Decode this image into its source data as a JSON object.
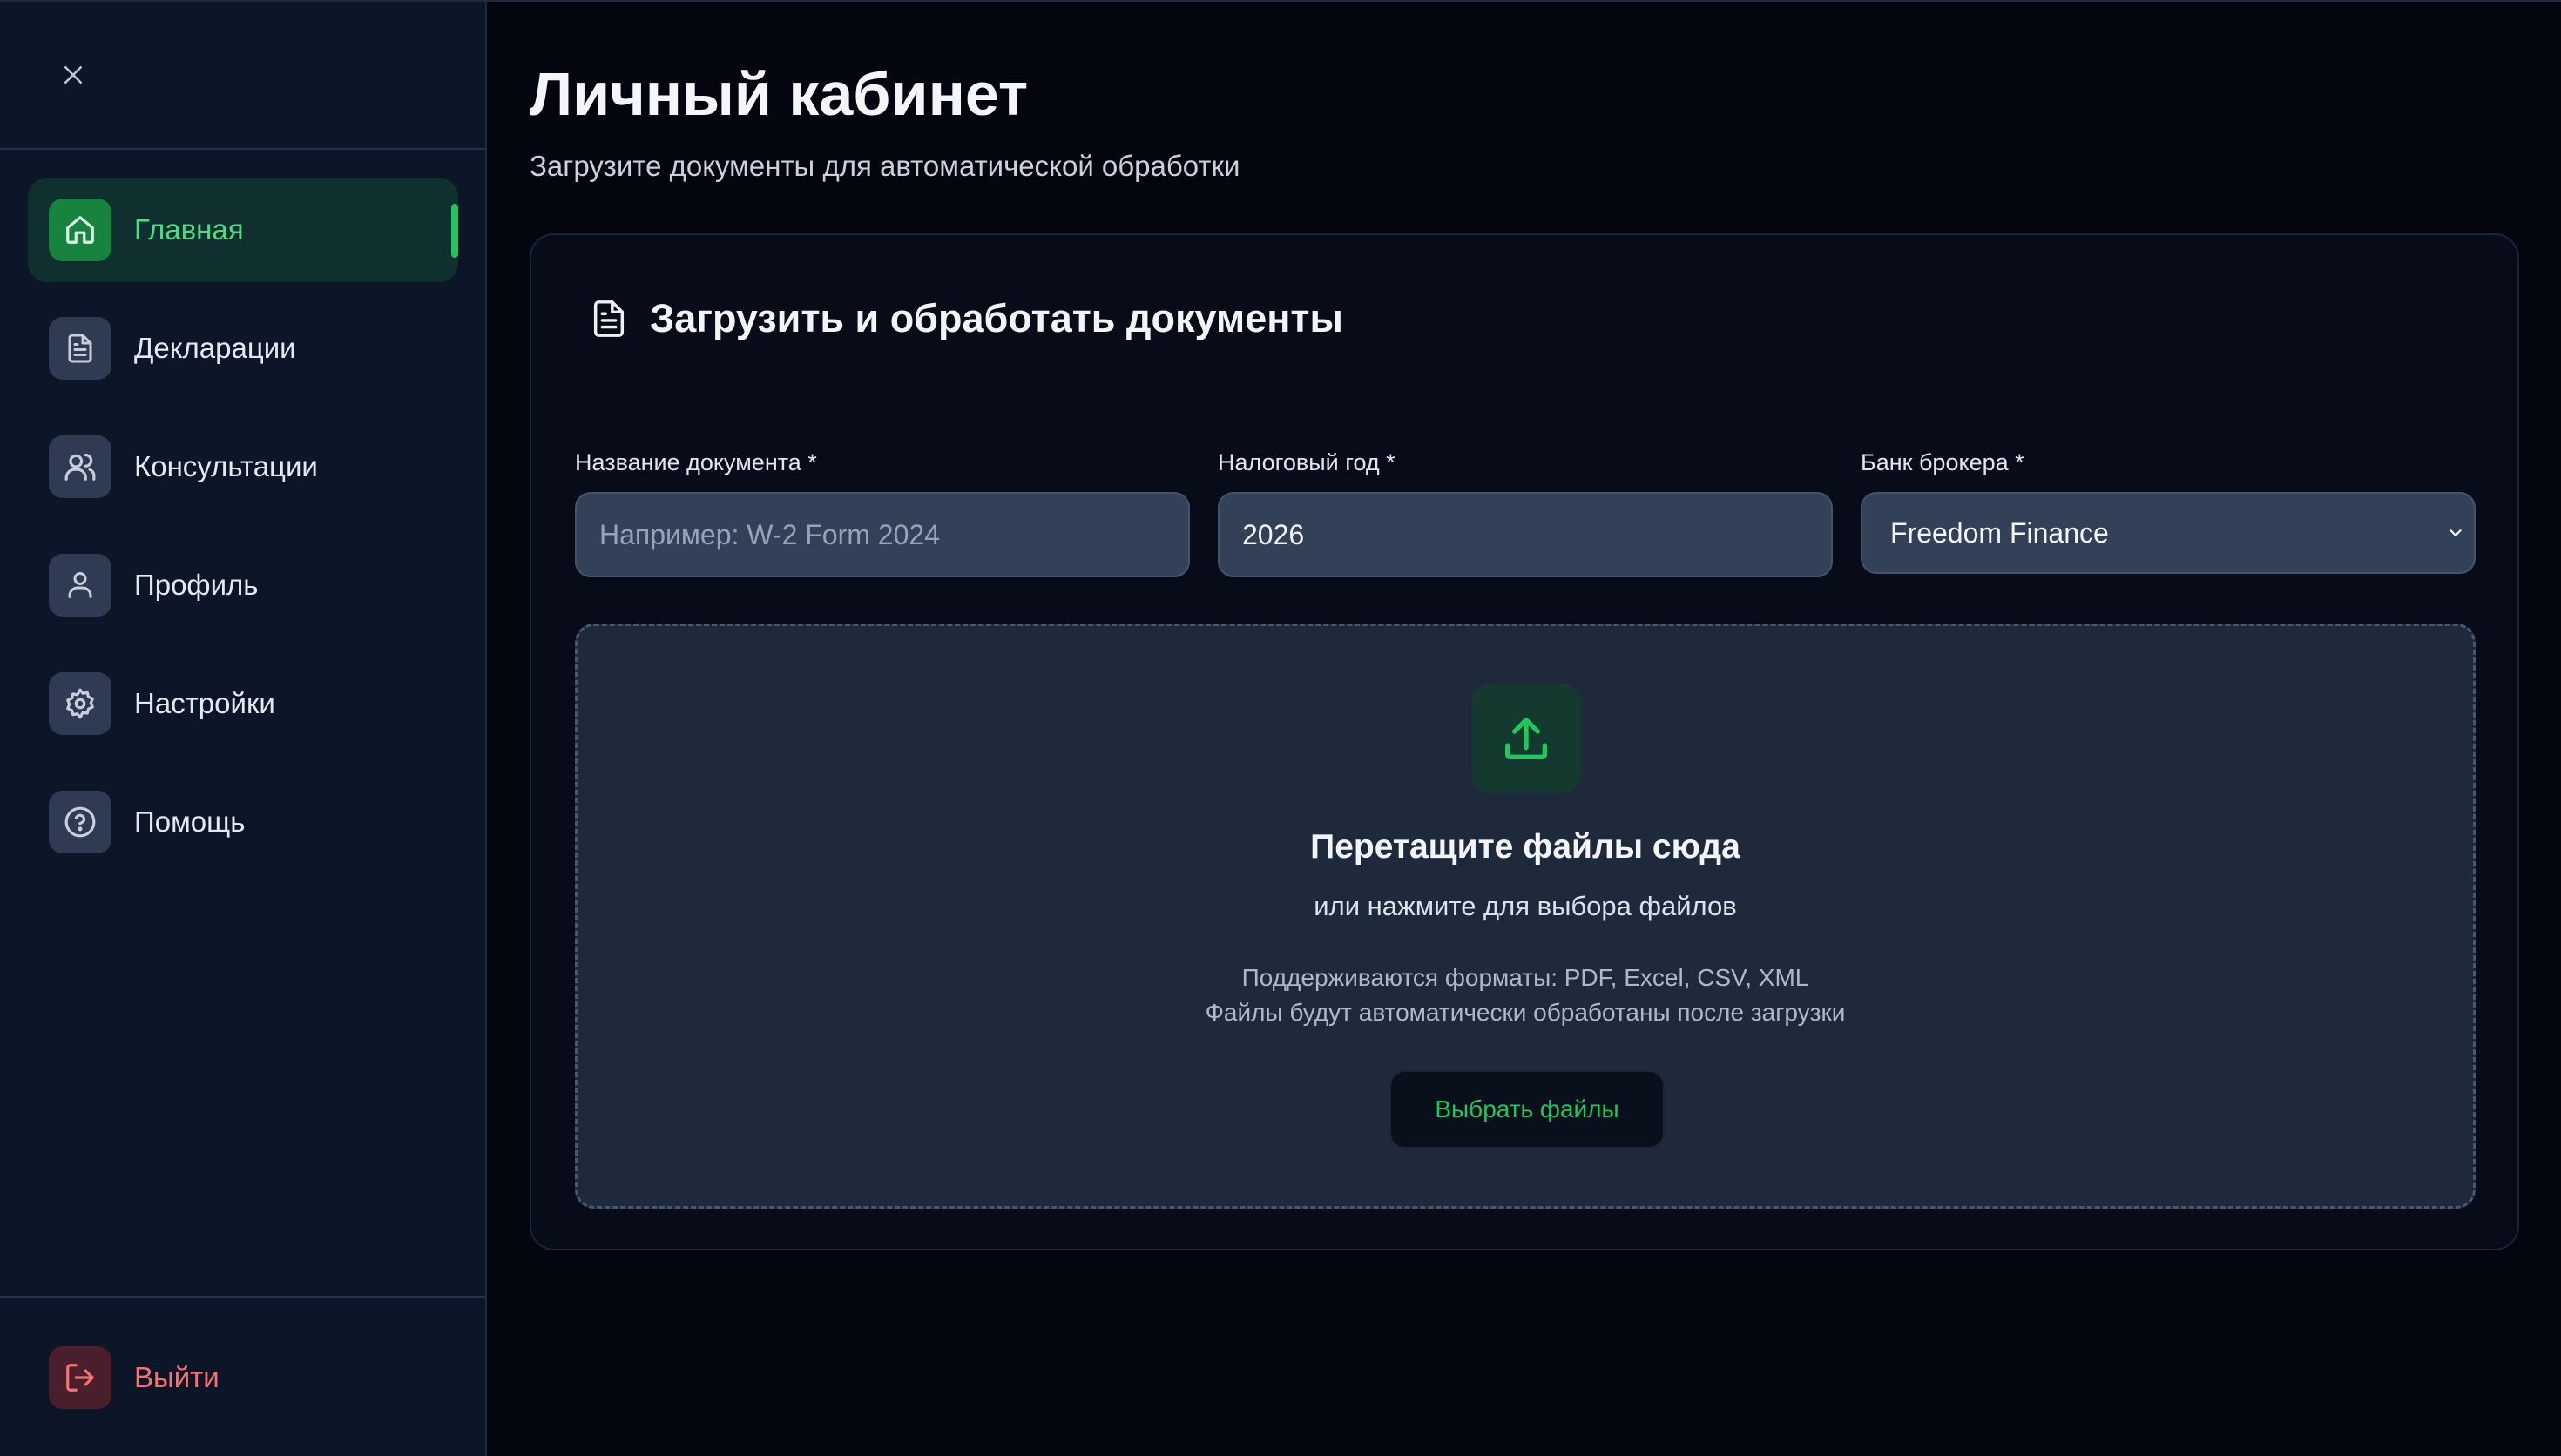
{
  "sidebar": {
    "close_icon": "close-icon",
    "items": [
      {
        "label": "Главная",
        "icon": "home-icon",
        "active": true
      },
      {
        "label": "Декларации",
        "icon": "file-text-icon"
      },
      {
        "label": "Консультации",
        "icon": "users-icon"
      },
      {
        "label": "Профиль",
        "icon": "user-icon"
      },
      {
        "label": "Настройки",
        "icon": "gear-icon"
      },
      {
        "label": "Помощь",
        "icon": "help-circle-icon"
      }
    ],
    "logout": {
      "label": "Выйти",
      "icon": "logout-icon"
    }
  },
  "header": {
    "title": "Личный кабинет",
    "subtitle": "Загрузите документы для автоматической обработки"
  },
  "upload_card": {
    "title": "Загрузить и обработать документы",
    "fields": {
      "doc_name": {
        "label": "Название документа *",
        "placeholder": "Например: W-2 Form 2024",
        "value": ""
      },
      "tax_year": {
        "label": "Налоговый год *",
        "value": "2026"
      },
      "broker_bank": {
        "label": "Банк брокера *",
        "value": "Freedom Finance"
      }
    },
    "dropzone": {
      "title": "Перетащите файлы сюда",
      "subtitle": "или нажмите для выбора файлов",
      "formats_line1": "Поддерживаются форматы: PDF, Excel, CSV, XML",
      "formats_line2": "Файлы будут автоматически обработаны после загрузки",
      "button_label": "Выбрать файлы"
    }
  },
  "colors": {
    "background": "#03060f",
    "sidebar": "#0d1628",
    "accent": "#22c55e",
    "active_text": "#4ade80",
    "danger": "#f87171"
  }
}
